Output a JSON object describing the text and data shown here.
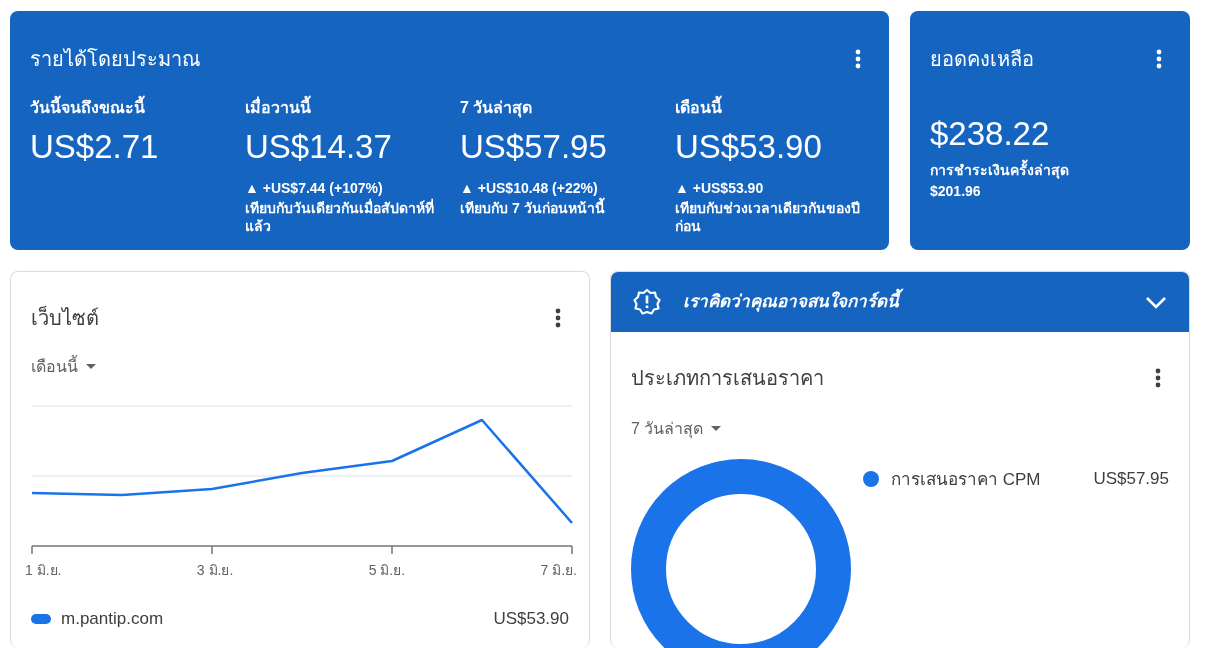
{
  "earnings": {
    "title": "รายได้โดยประมาณ",
    "metrics": [
      {
        "label": "วันนี้จนถึงขณะนี้",
        "value": "US$2.71"
      },
      {
        "label": "เมื่อวานนี้",
        "value": "US$14.37",
        "change": "▲ +US$7.44 (+107%)",
        "comparison": "เทียบกับวันเดียวกันเมื่อสัปดาห์ที่แล้ว"
      },
      {
        "label": "7 วันล่าสุด",
        "value": "US$57.95",
        "change": "▲ +US$10.48 (+22%)",
        "comparison": "เทียบกับ 7 วันก่อนหน้านี้"
      },
      {
        "label": "เดือนนี้",
        "value": "US$53.90",
        "change": "▲ +US$53.90",
        "comparison": "เทียบกับช่วงเวลาเดียวกันของปีก่อน"
      }
    ]
  },
  "balance": {
    "title": "ยอดคงเหลือ",
    "amount": "$238.22",
    "last_payment_label": "การชำระเงินครั้งล่าสุด",
    "last_payment": "$201.96"
  },
  "sites": {
    "title": "เว็บไซต์",
    "period": "เดือนนี้",
    "axis_labels": [
      "1 มิ.ย.",
      "3 มิ.ย.",
      "5 มิ.ย.",
      "7 มิ.ย."
    ],
    "legend": {
      "name": "m.pantip.com",
      "value": "US$53.90"
    }
  },
  "bid_types": {
    "banner": "เราคิดว่าคุณอาจสนใจการ์ดนี้",
    "title": "ประเภทการเสนอราคา",
    "period": "7 วันล่าสุด",
    "legend": [
      {
        "name": "การเสนอราคา CPM",
        "value": "US$57.95",
        "color": "#1a73e8"
      }
    ]
  }
}
